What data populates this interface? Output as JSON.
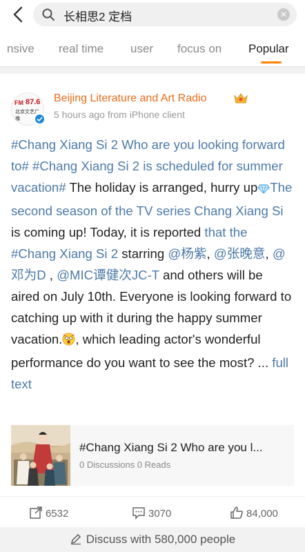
{
  "search": {
    "query": "长相思2 定档"
  },
  "tabs": [
    {
      "label": "nsive"
    },
    {
      "label": "real time"
    },
    {
      "label": "user"
    },
    {
      "label": "focus on"
    },
    {
      "label": "Popular",
      "active": true
    }
  ],
  "post": {
    "author": "Beijing Literature and Art Radio",
    "avatar": {
      "brand": "FM",
      "number": "87.6",
      "subtitle": "北京文艺广播"
    },
    "meta": "5 hours ago from iPhone client",
    "segments": [
      {
        "text": "#Chang Xiang Si 2 Who are you looking forward to# ",
        "link": true
      },
      {
        "text": "#Chang Xiang Si 2 is scheduled for summer vacation#",
        "link": true
      },
      {
        "text": " The holiday is arranged, hurry up",
        "link": false
      },
      {
        "text": "The second season of the TV series Chang Xiang Si",
        "link": true
      },
      {
        "text": " is coming up! Today, it is reported ",
        "link": false
      },
      {
        "text": "that the #Chang Xiang Si 2",
        "link": true
      },
      {
        "text": " starring ",
        "link": false
      },
      {
        "text": "@杨紫",
        "link": true
      },
      {
        "text": ", ",
        "link": false
      },
      {
        "text": "@张晚意",
        "link": true
      },
      {
        "text": ", ",
        "link": false
      },
      {
        "text": "@邓为D",
        "link": true
      },
      {
        "text": " , ",
        "link": false
      },
      {
        "text": "@MIC谭健次JC-T",
        "link": true
      },
      {
        "text": " and others will be aired on July 10th. Everyone is looking forward to catching up with it during the happy summer vacation.",
        "link": false
      },
      {
        "text": ", which leading actor's wonderful performance do you want to see the most? ... ",
        "link": false
      },
      {
        "text": "full text",
        "link": true
      }
    ],
    "topic": {
      "title": "#Chang Xiang Si 2 Who are you l...",
      "stats": "0 Discussions 0 Reads"
    },
    "actions": {
      "reposts": "6532",
      "comments": "3070",
      "likes": "84,000"
    }
  },
  "footer": {
    "discuss": "Discuss with 580,000 people"
  },
  "colors": {
    "accent": "#ff8200",
    "link": "#4d7aa8",
    "author": "#e86c1a"
  }
}
